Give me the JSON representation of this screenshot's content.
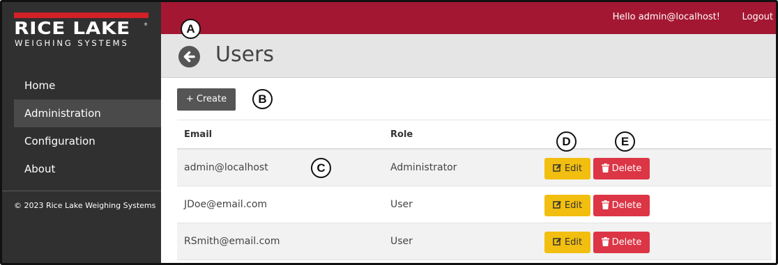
{
  "brand": {
    "name": "RICE LAKE",
    "registered": "®",
    "tagline": "WEIGHING SYSTEMS"
  },
  "sidebar": {
    "items": [
      {
        "label": "Home",
        "active": false
      },
      {
        "label": "Administration",
        "active": true
      },
      {
        "label": "Configuration",
        "active": false
      },
      {
        "label": "About",
        "active": false
      }
    ],
    "copyright": "© 2023 Rice Lake Weighing Systems"
  },
  "topbar": {
    "greeting": "Hello admin@localhost!",
    "logout_label": "Logout"
  },
  "header": {
    "title": "Users",
    "back_icon": "circle-arrow-left-icon"
  },
  "toolbar": {
    "create_label": "+ Create"
  },
  "table": {
    "columns": [
      "Email",
      "Role"
    ],
    "rows": [
      {
        "email": "admin@localhost",
        "role": "Administrator"
      },
      {
        "email": "JDoe@email.com",
        "role": "User"
      },
      {
        "email": "RSmith@email.com",
        "role": "User"
      }
    ],
    "edit_label": "Edit",
    "delete_label": "Delete",
    "edit_icon": "edit-icon",
    "delete_icon": "trash-icon"
  },
  "callouts": [
    "A",
    "B",
    "C",
    "D",
    "E"
  ],
  "colors": {
    "topbar": "#a41732",
    "sidebar": "#303030",
    "brand_red": "#d42027",
    "edit": "#f2be0f",
    "delete": "#dc3545",
    "create": "#555555"
  }
}
